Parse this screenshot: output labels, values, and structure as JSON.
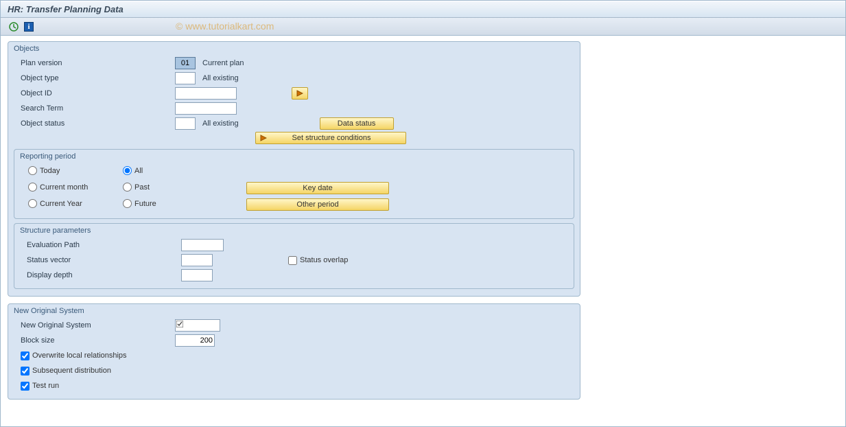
{
  "title": "HR: Transfer Planning Data",
  "watermark": "© www.tutorialkart.com",
  "objects": {
    "group_title": "Objects",
    "plan_version": {
      "label": "Plan version",
      "code": "01",
      "text": "Current plan"
    },
    "object_type": {
      "label": "Object type",
      "code": "",
      "text": "All existing"
    },
    "object_id": {
      "label": "Object ID",
      "value": ""
    },
    "search_term": {
      "label": "Search Term",
      "value": ""
    },
    "object_status": {
      "label": "Object status",
      "code": "",
      "text": "All existing"
    },
    "data_status_btn": "Data status",
    "set_structure_btn": "Set structure conditions"
  },
  "reporting": {
    "group_title": "Reporting period",
    "today": "Today",
    "all": "All",
    "current_month": "Current month",
    "past": "Past",
    "current_year": "Current Year",
    "future": "Future",
    "selected": "all",
    "key_date_btn": "Key date",
    "other_period_btn": "Other period"
  },
  "structure": {
    "group_title": "Structure parameters",
    "eval_path": {
      "label": "Evaluation Path",
      "value": ""
    },
    "status_vector": {
      "label": "Status vector",
      "value": ""
    },
    "status_overlap": {
      "label": "Status overlap",
      "checked": false
    },
    "display_depth": {
      "label": "Display depth",
      "value": ""
    }
  },
  "new_system": {
    "group_title": "New Original System",
    "new_original": {
      "label": "New Original System",
      "value": "",
      "has_help": true
    },
    "block_size": {
      "label": "Block size",
      "value": "200"
    },
    "overwrite": {
      "label": "Overwrite local relationships",
      "checked": true
    },
    "subsequent": {
      "label": "Subsequent distribution",
      "checked": true
    },
    "test_run": {
      "label": "Test run",
      "checked": true
    }
  }
}
